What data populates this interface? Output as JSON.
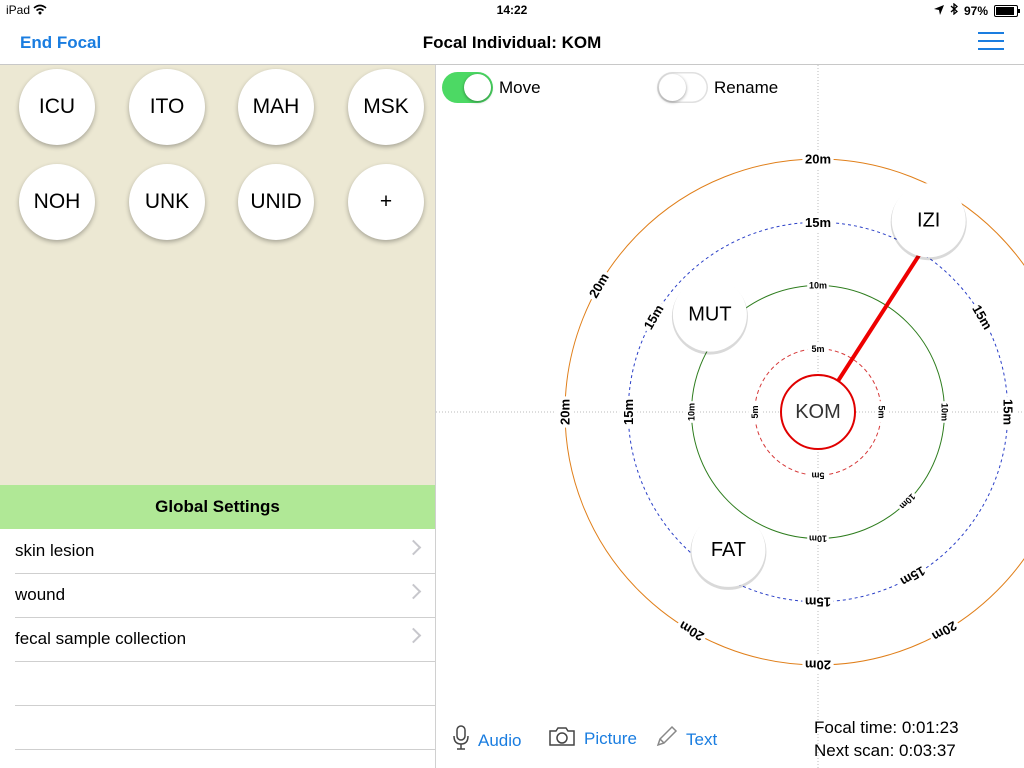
{
  "status_bar": {
    "device": "iPad",
    "time": "14:22",
    "battery": "97%"
  },
  "nav": {
    "left_button": "End Focal",
    "title": "Focal Individual: KOM",
    "menu_icon": "hamburger-menu-icon"
  },
  "individual_chips": [
    {
      "label": "ICU"
    },
    {
      "label": "ITO"
    },
    {
      "label": "MAH"
    },
    {
      "label": "MSK"
    },
    {
      "label": "NOH"
    },
    {
      "label": "UNK"
    },
    {
      "label": "UNID"
    },
    {
      "label": "+"
    }
  ],
  "global_settings": {
    "header": "Global Settings",
    "rows": [
      {
        "label": "skin lesion"
      },
      {
        "label": "wound"
      },
      {
        "label": "fecal sample collection"
      }
    ]
  },
  "toggles": {
    "move_label": "Move",
    "move_on": true,
    "rename_label": "Rename",
    "rename_on": false
  },
  "radar": {
    "focal": "KOM",
    "rings": [
      {
        "label": "5m",
        "color": "#d63a3a"
      },
      {
        "label": "10m",
        "color": "#2e7d1e"
      },
      {
        "label": "15m",
        "color": "#2a3fc7"
      },
      {
        "label": "20m",
        "color": "#e07f1a"
      }
    ],
    "individuals": [
      {
        "label": "IZI",
        "distance_m": 17.5,
        "bearing_deg": 30
      },
      {
        "label": "MUT",
        "distance_m": 11.5,
        "bearing_deg": -48
      },
      {
        "label": "FAT",
        "distance_m": 13,
        "bearing_deg": -147
      }
    ],
    "link_color": "#ee0000"
  },
  "bottom": {
    "audio_label": "Audio",
    "picture_label": "Picture",
    "text_label": "Text",
    "focal_time": "Focal time: 0:01:23",
    "next_scan": "Next scan: 0:03:37"
  }
}
